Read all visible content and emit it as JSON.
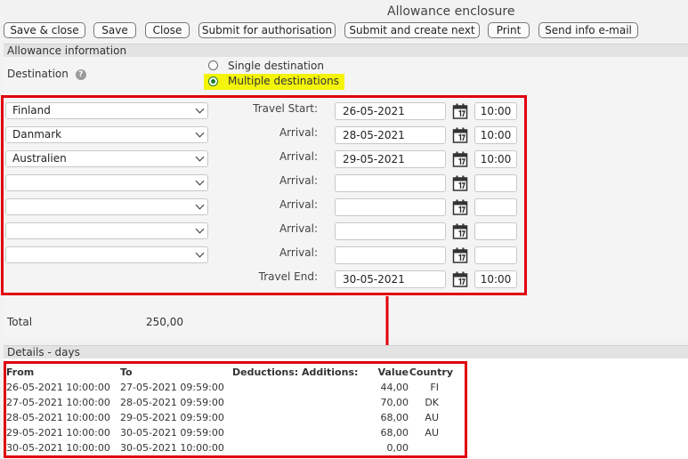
{
  "window": {
    "title": "Allowance enclosure"
  },
  "toolbar": {
    "buttons": [
      {
        "label": "Save & close"
      },
      {
        "label": "Save"
      },
      {
        "label": "Close"
      },
      {
        "label": "Submit for authorisation"
      },
      {
        "label": "Submit and create next"
      },
      {
        "label": "Print"
      },
      {
        "label": "Send info e-mail"
      }
    ]
  },
  "allowance": {
    "section_title": "Allowance information",
    "destination_label": "Destination",
    "help_icon": "?",
    "options": [
      {
        "label": "Single destination",
        "selected": false
      },
      {
        "label": "Multiple destinations",
        "selected": true
      }
    ],
    "rows": [
      {
        "country": "Finland",
        "label": "Travel Start:",
        "date": "26-05-2021",
        "time": "10:00"
      },
      {
        "country": "Danmark",
        "label": "Arrival:",
        "date": "28-05-2021",
        "time": "10:00"
      },
      {
        "country": "Australien",
        "label": "Arrival:",
        "date": "29-05-2021",
        "time": "10:00"
      },
      {
        "country": "",
        "label": "Arrival:",
        "date": "",
        "time": ""
      },
      {
        "country": "",
        "label": "Arrival:",
        "date": "",
        "time": ""
      },
      {
        "country": "",
        "label": "Arrival:",
        "date": "",
        "time": ""
      },
      {
        "country": "",
        "label": "Arrival:",
        "date": "",
        "time": ""
      },
      {
        "country": "",
        "label": "Travel End:",
        "date": "30-05-2021",
        "time": "10:00"
      }
    ],
    "total_label": "Total",
    "total_value": "250,00"
  },
  "details": {
    "section_title": "Details - days",
    "headers": {
      "from": "From",
      "to": "To",
      "deductions": "Deductions:",
      "additions": "Additions:",
      "value": "Value",
      "country": "Country"
    },
    "rows": [
      {
        "from": "26-05-2021 10:00:00",
        "to": "27-05-2021 09:59:00",
        "value": "44,00",
        "country": "FI"
      },
      {
        "from": "27-05-2021 10:00:00",
        "to": "28-05-2021 09:59:00",
        "value": "70,00",
        "country": "DK"
      },
      {
        "from": "28-05-2021 10:00:00",
        "to": "29-05-2021 09:59:00",
        "value": "68,00",
        "country": "AU"
      },
      {
        "from": "29-05-2021 10:00:00",
        "to": "30-05-2021 09:59:00",
        "value": "68,00",
        "country": "AU"
      },
      {
        "from": "30-05-2021 10:00:00",
        "to": "30-05-2021 10:00:00",
        "value": "0,00",
        "country": ""
      }
    ]
  },
  "colors": {
    "highlight": "#f4f40a",
    "annotation_red": "#e0000b",
    "radio_green": "#1d7a2d"
  }
}
